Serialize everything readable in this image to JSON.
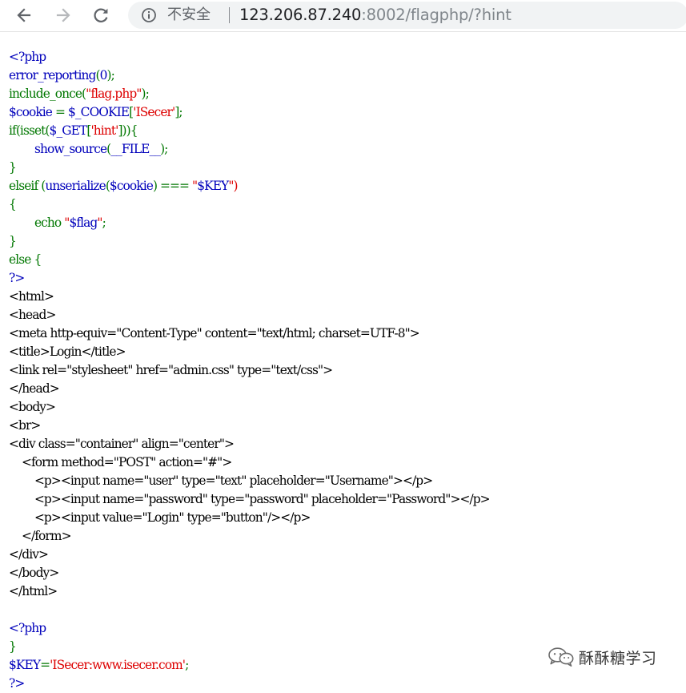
{
  "browser": {
    "back_icon": "arrow-left-icon",
    "forward_icon": "arrow-right-icon",
    "reload_icon": "reload-icon",
    "security_icon": "info-circle-icon",
    "security_text": "不安全",
    "url_host": "123.206.87.240",
    "url_rest": ":8002/flagphp/?hint"
  },
  "colors": {
    "default": "#000000",
    "keyword": "#007700",
    "html": "#0000BB",
    "string": "#DD0000"
  },
  "source": {
    "lines": [
      [
        {
          "t": "<?php",
          "c": "html"
        }
      ],
      [
        {
          "t": "error_reporting",
          "c": "html"
        },
        {
          "t": "(",
          "c": "keyword"
        },
        {
          "t": "0",
          "c": "html"
        },
        {
          "t": ");",
          "c": "keyword"
        }
      ],
      [
        {
          "t": "include_once(",
          "c": "keyword"
        },
        {
          "t": "\"flag.php\"",
          "c": "string"
        },
        {
          "t": ");",
          "c": "keyword"
        }
      ],
      [
        {
          "t": "$cookie ",
          "c": "html"
        },
        {
          "t": "= ",
          "c": "keyword"
        },
        {
          "t": "$_COOKIE",
          "c": "html"
        },
        {
          "t": "[",
          "c": "keyword"
        },
        {
          "t": "'ISecer'",
          "c": "string"
        },
        {
          "t": "];",
          "c": "keyword"
        }
      ],
      [
        {
          "t": "if(isset(",
          "c": "keyword"
        },
        {
          "t": "$_GET",
          "c": "html"
        },
        {
          "t": "[",
          "c": "keyword"
        },
        {
          "t": "'hint'",
          "c": "string"
        },
        {
          "t": "])){",
          "c": "keyword"
        }
      ],
      [
        {
          "t": "        ",
          "c": "keyword"
        },
        {
          "t": "show_source",
          "c": "html"
        },
        {
          "t": "(",
          "c": "keyword"
        },
        {
          "t": "__FILE__",
          "c": "html"
        },
        {
          "t": ");",
          "c": "keyword"
        }
      ],
      [
        {
          "t": "}",
          "c": "keyword"
        }
      ],
      [
        {
          "t": "elseif ",
          "c": "keyword"
        },
        {
          "t": "(",
          "c": "keyword"
        },
        {
          "t": "unserialize",
          "c": "html"
        },
        {
          "t": "(",
          "c": "keyword"
        },
        {
          "t": "$cookie",
          "c": "html"
        },
        {
          "t": ") ",
          "c": "keyword"
        },
        {
          "t": "=== ",
          "c": "keyword"
        },
        {
          "t": "\"",
          "c": "string"
        },
        {
          "t": "$KEY",
          "c": "html"
        },
        {
          "t": "\")",
          "c": "string"
        }
      ],
      [
        {
          "t": "{",
          "c": "keyword"
        }
      ],
      [
        {
          "t": "        echo ",
          "c": "keyword"
        },
        {
          "t": "\"",
          "c": "string"
        },
        {
          "t": "$flag",
          "c": "html"
        },
        {
          "t": "\"",
          "c": "string"
        },
        {
          "t": ";",
          "c": "keyword"
        }
      ],
      [
        {
          "t": "}",
          "c": "keyword"
        }
      ],
      [
        {
          "t": "else ",
          "c": "keyword"
        },
        {
          "t": "{",
          "c": "keyword"
        }
      ],
      [
        {
          "t": "?>",
          "c": "html"
        }
      ],
      [
        {
          "t": "<html>",
          "c": "default"
        }
      ],
      [
        {
          "t": "<head>",
          "c": "default"
        }
      ],
      [
        {
          "t": "<meta http-equiv=\"Content-Type\" content=\"text/html; charset=UTF-8\">",
          "c": "default"
        }
      ],
      [
        {
          "t": "<title>Login</title>",
          "c": "default"
        }
      ],
      [
        {
          "t": "<link rel=\"stylesheet\" href=\"admin.css\" type=\"text/css\">",
          "c": "default"
        }
      ],
      [
        {
          "t": "</head>",
          "c": "default"
        }
      ],
      [
        {
          "t": "<body>",
          "c": "default"
        }
      ],
      [
        {
          "t": "<br>",
          "c": "default"
        }
      ],
      [
        {
          "t": "<div class=\"container\" align=\"center\">",
          "c": "default"
        }
      ],
      [
        {
          "t": "    <form method=\"POST\" action=\"#\">",
          "c": "default"
        }
      ],
      [
        {
          "t": "        <p><input name=\"user\" type=\"text\" placeholder=\"Username\"></p>",
          "c": "default"
        }
      ],
      [
        {
          "t": "        <p><input name=\"password\" type=\"password\" placeholder=\"Password\"></p>",
          "c": "default"
        }
      ],
      [
        {
          "t": "        <p><input value=\"Login\" type=\"button\"/></p>",
          "c": "default"
        }
      ],
      [
        {
          "t": "    </form>",
          "c": "default"
        }
      ],
      [
        {
          "t": "</div>",
          "c": "default"
        }
      ],
      [
        {
          "t": "</body>",
          "c": "default"
        }
      ],
      [
        {
          "t": "</html>",
          "c": "default"
        }
      ],
      [],
      [
        {
          "t": "<?php",
          "c": "html"
        }
      ],
      [
        {
          "t": "}",
          "c": "keyword"
        }
      ],
      [
        {
          "t": "$KEY",
          "c": "html"
        },
        {
          "t": "=",
          "c": "keyword"
        },
        {
          "t": "'ISecer:www.isecer.com'",
          "c": "string"
        },
        {
          "t": ";",
          "c": "keyword"
        }
      ],
      [
        {
          "t": "?>",
          "c": "html"
        }
      ]
    ]
  },
  "watermark": {
    "icon": "wechat-icon",
    "text": "酥酥糖学习"
  }
}
